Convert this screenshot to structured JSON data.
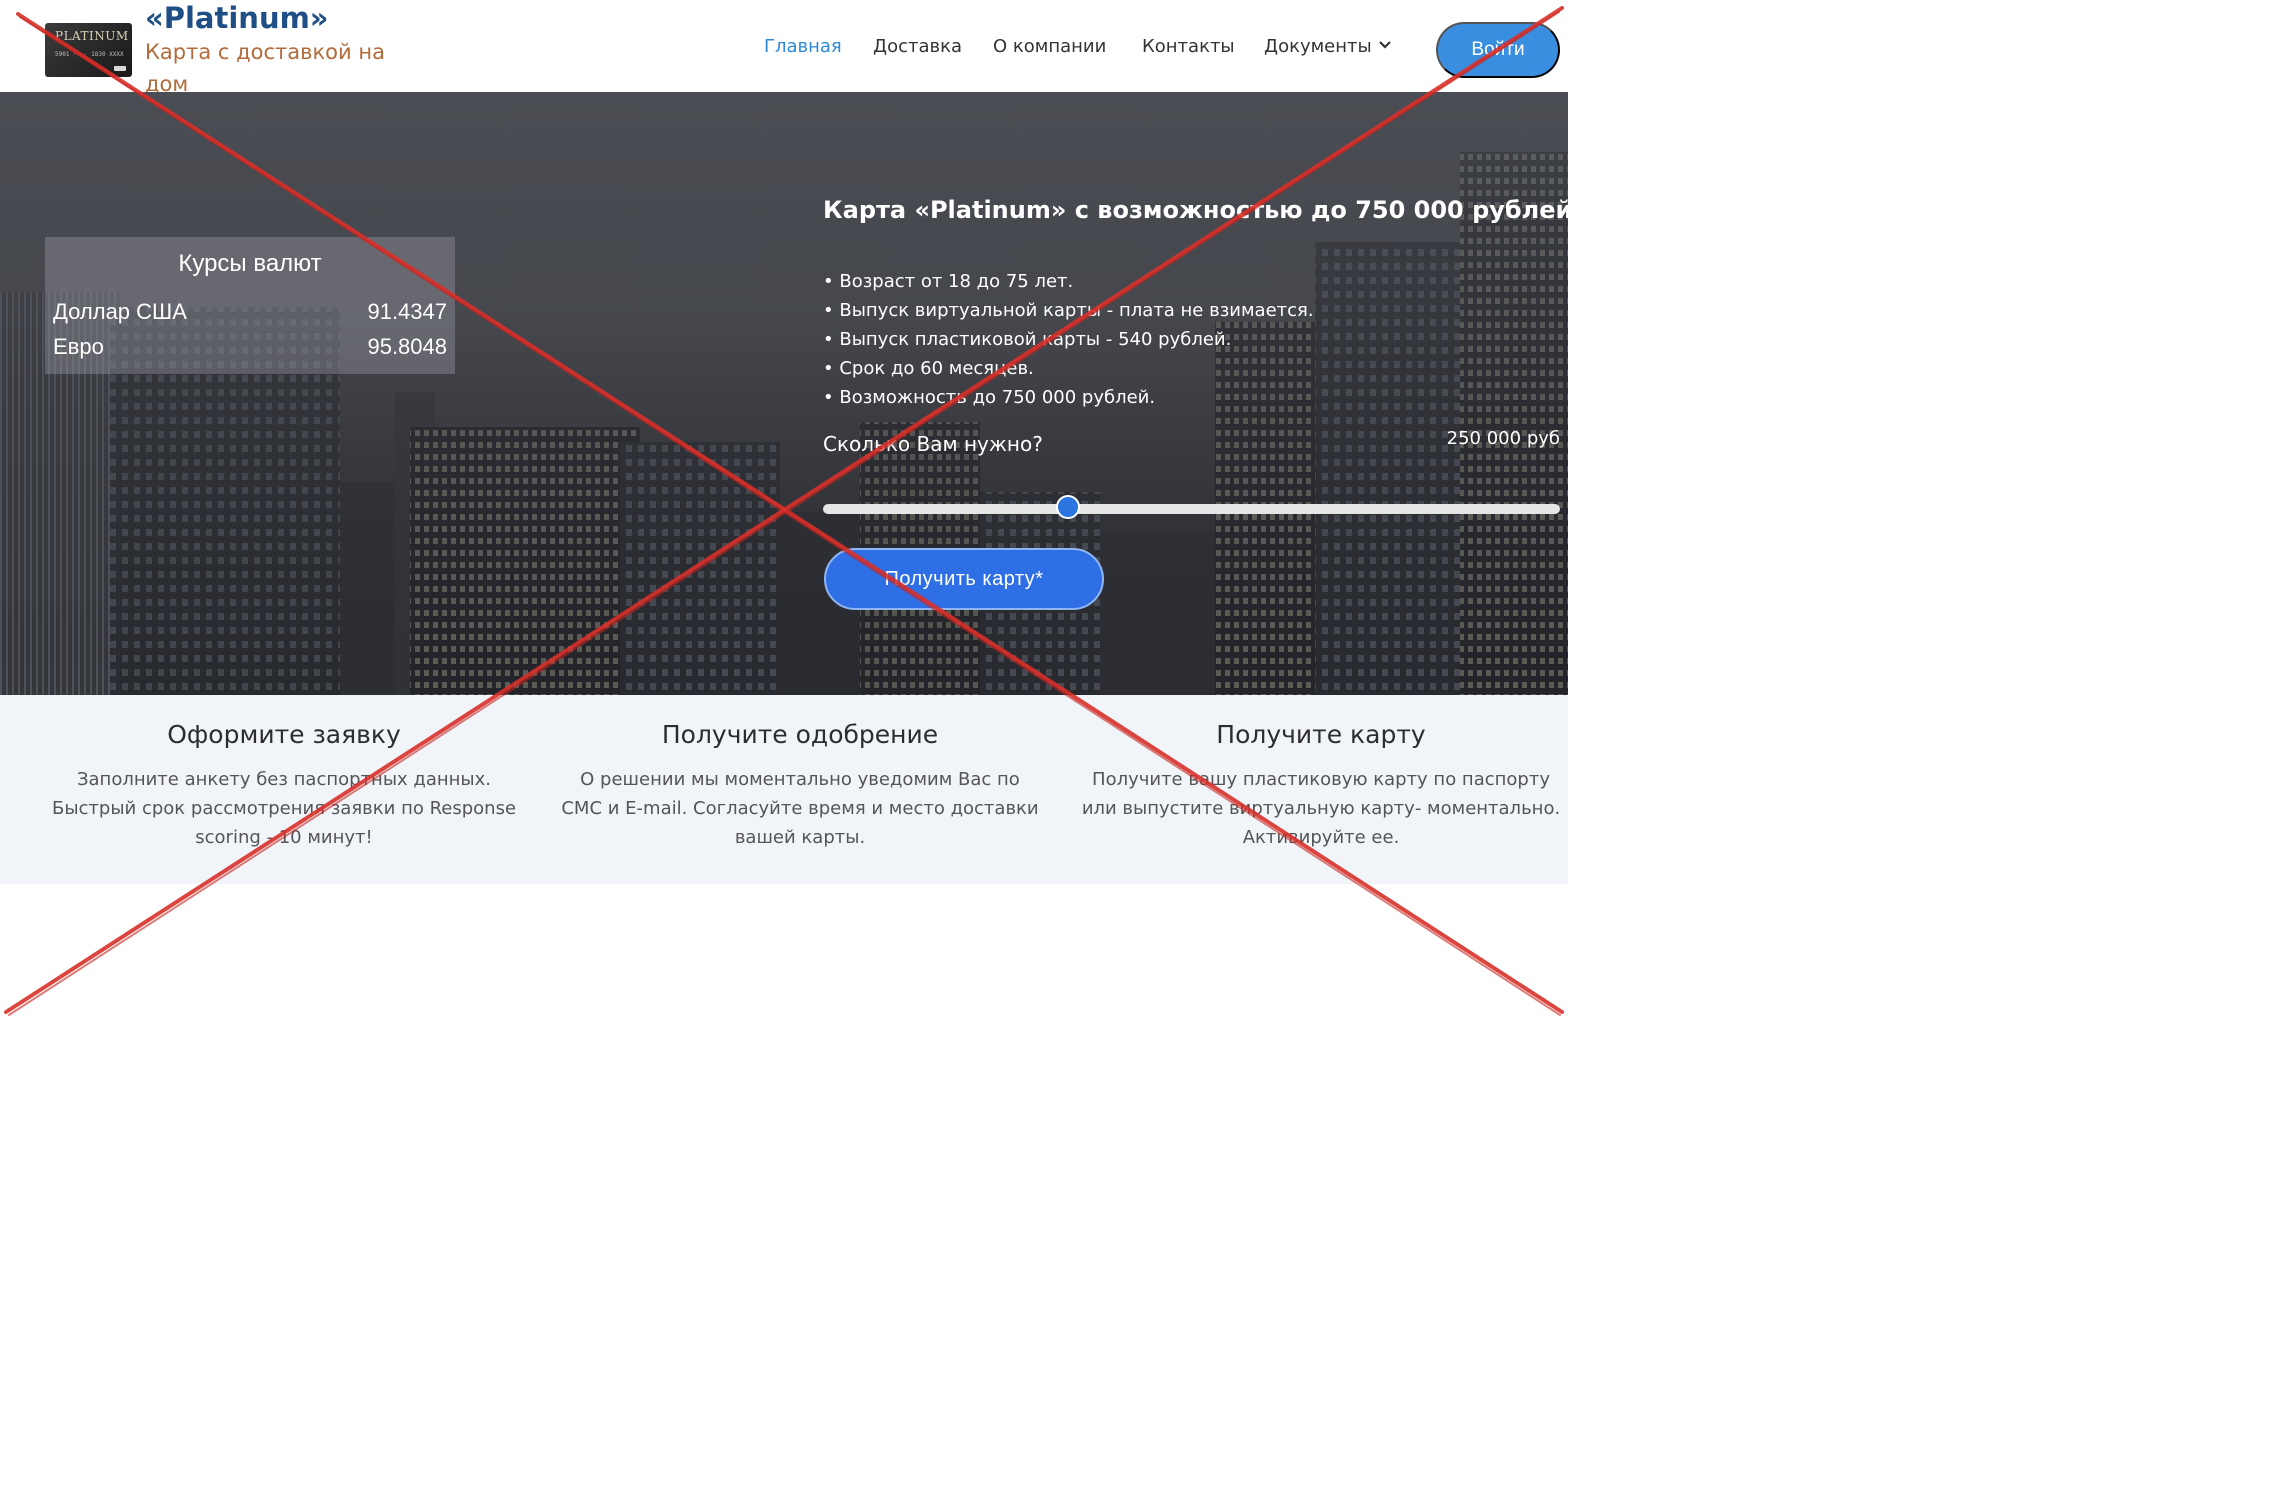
{
  "header": {
    "logo_text": "PLATINUM",
    "logo_number": "5901 ···· 1830 XXXX",
    "brand_title": "«Platinum»",
    "brand_tagline": "Карта с доставкой на дом",
    "nav": [
      {
        "label": "Главная",
        "active": true
      },
      {
        "label": "Доставка",
        "active": false
      },
      {
        "label": "О компании",
        "active": false
      },
      {
        "label": "Контакты",
        "active": false
      },
      {
        "label": "Документы",
        "active": false,
        "has_dropdown": true
      }
    ],
    "login_label": "Войти"
  },
  "rates": {
    "title": "Курсы валют",
    "items": [
      {
        "name": "Доллар США",
        "value": "91.4347"
      },
      {
        "name": "Евро",
        "value": "95.8048"
      }
    ]
  },
  "offer": {
    "title": "Карта «Platinum» с возможностью до 750 000 рублей.",
    "features": [
      "• Возраст от 18 до 75 лет.",
      "• Выпуск виртуальной карты - плата не взимается.",
      "• Выпуск пластиковой карты - 540 рублей.",
      "• Срок до 60 месяцев.",
      "• Возможность до 750 000 рублей."
    ],
    "amount_question": "Сколько Вам нужно?",
    "amount_value": "250 000 руб",
    "slider_fraction": 0.333,
    "cta_label": "Получить карту*"
  },
  "steps": [
    {
      "title": "Оформите заявку",
      "text": "Заполните анкету без паспортных данных. Быстрый срок рассмотрения заявки по Response scoring - 10 минут!"
    },
    {
      "title": "Получите одобрение",
      "text": "О решении мы моментально уведомим Вас по СМС и E-mail. Согласуйте время и место доставки вашей карты."
    },
    {
      "title": "Получите карту",
      "text": "Получите вашу пластиковую карту по паспорту или выпустите виртуальную карту- моментально. Активируйте ее."
    }
  ],
  "colors": {
    "brand_title": "#1f4f86",
    "brand_tagline": "#b26b3a",
    "nav_active": "#2e8ad6",
    "login_button": "#3a8ee0",
    "cta_button": "#2f6fe6",
    "cross": "#d9302a"
  }
}
